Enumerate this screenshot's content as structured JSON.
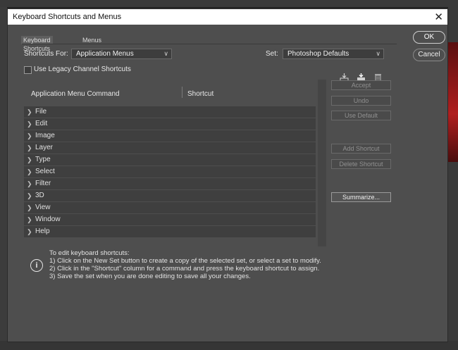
{
  "dialog": {
    "title": "Keyboard Shortcuts and Menus",
    "close_glyph": "✕"
  },
  "tabs": [
    {
      "label": "Keyboard Shortcuts",
      "active": true
    },
    {
      "label": "Menus",
      "active": false
    }
  ],
  "shortcuts_for": {
    "label": "Shortcuts For:",
    "value": "Application Menus"
  },
  "set": {
    "label": "Set:",
    "value": "Photoshop Defaults"
  },
  "legacy": {
    "label": "Use Legacy Channel Shortcuts",
    "checked": false
  },
  "icons": {
    "save_set": "save-set-icon",
    "new_set": "new-set-icon",
    "delete_set": "delete-set-icon"
  },
  "table": {
    "col1": "Application Menu Command",
    "col2": "Shortcut",
    "rows": [
      "File",
      "Edit",
      "Image",
      "Layer",
      "Type",
      "Select",
      "Filter",
      "3D",
      "View",
      "Window",
      "Help"
    ]
  },
  "buttons": {
    "ok": "OK",
    "cancel": "Cancel",
    "accept": "Accept",
    "undo": "Undo",
    "use_default": "Use Default",
    "add_shortcut": "Add Shortcut",
    "delete_shortcut": "Delete Shortcut",
    "summarize": "Summarize..."
  },
  "info": {
    "heading": "To edit keyboard shortcuts:",
    "step1": "1) Click on the New Set button to create a copy of the selected set, or select a set to modify.",
    "step2": "2) Click in the \"Shortcut\" column for a command and press the keyboard shortcut to assign.",
    "step3": "3) Save the set when you are done editing to save all your changes."
  }
}
